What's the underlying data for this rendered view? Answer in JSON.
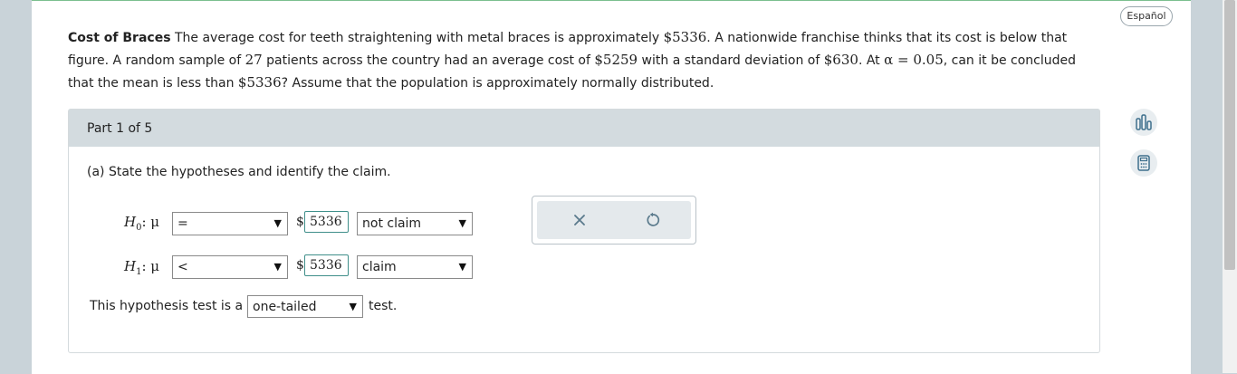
{
  "language_button": "Español",
  "problem": {
    "title": "Cost of Braces",
    "seg1": " The average cost for teeth straightening with metal braces is approximately ",
    "price1": "$5336",
    "seg2": ". A nationwide franchise thinks that its cost is below that figure. A random sample of ",
    "sample_size": "27",
    "seg3": " patients across the country had an average cost of ",
    "price2": "$5259",
    "seg4": " with a standard deviation of ",
    "price3": "$630",
    "seg5": ". At ",
    "alpha": "α = 0.05",
    "seg6": ", can it be concluded that the mean is less than ",
    "price4": "$5336",
    "seg7": "? Assume that the population is approximately normally distributed."
  },
  "part": {
    "header": "Part 1 of 5",
    "question": "(a) State the hypotheses and identify the claim."
  },
  "h0": {
    "label_main": "H",
    "label_sub": "0",
    "label_rest": ": μ",
    "operator": "=",
    "dollar": "$",
    "value": "5336",
    "claim": "not claim"
  },
  "h1": {
    "label_main": "H",
    "label_sub": "1",
    "label_rest": ": μ",
    "operator": "<",
    "dollar": "$",
    "value": "5336",
    "claim": "claim"
  },
  "test_type": {
    "prefix": "This hypothesis test is a",
    "selected": "one-tailed",
    "suffix": "test."
  },
  "icons": {
    "dropdown_arrow": "▼",
    "side_top": "bar-chart-icon",
    "side_bottom": "calculator-icon",
    "clear": "close-icon",
    "reset": "undo-icon"
  },
  "colors": {
    "accent_teal": "#3f8f8a",
    "panel_header": "#d3dbdf",
    "side_icon": "#3d6f8c"
  }
}
